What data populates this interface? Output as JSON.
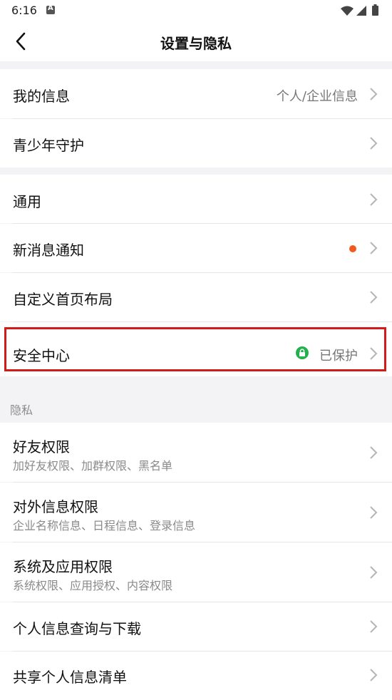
{
  "status_bar": {
    "time": "6:16"
  },
  "header": {
    "title": "设置与隐私"
  },
  "group1": {
    "my_info": {
      "label": "我的信息",
      "value": "个人/企业信息"
    },
    "youth": {
      "label": "青少年守护"
    }
  },
  "group2": {
    "general": {
      "label": "通用"
    },
    "notifications": {
      "label": "新消息通知"
    },
    "custom_home": {
      "label": "自定义首页布局"
    },
    "security": {
      "label": "安全中心",
      "value": "已保护"
    }
  },
  "privacy_section": {
    "title": "隐私",
    "friend_perm": {
      "label": "好友权限",
      "sub": "加好友权限、加群权限、黑名单"
    },
    "external_info": {
      "label": "对外信息权限",
      "sub": "企业名称信息、日程信息、登录信息"
    },
    "system_perm": {
      "label": "系统及应用权限",
      "sub": "系统权限、应用授权、内容权限"
    },
    "personal_query": {
      "label": "个人信息查询与下载"
    },
    "shared_list": {
      "label": "共享个人信息清单"
    }
  },
  "colors": {
    "accent_dot": "#f05a1f",
    "protected_green": "#22b14c",
    "highlight": "#d11a1a"
  }
}
